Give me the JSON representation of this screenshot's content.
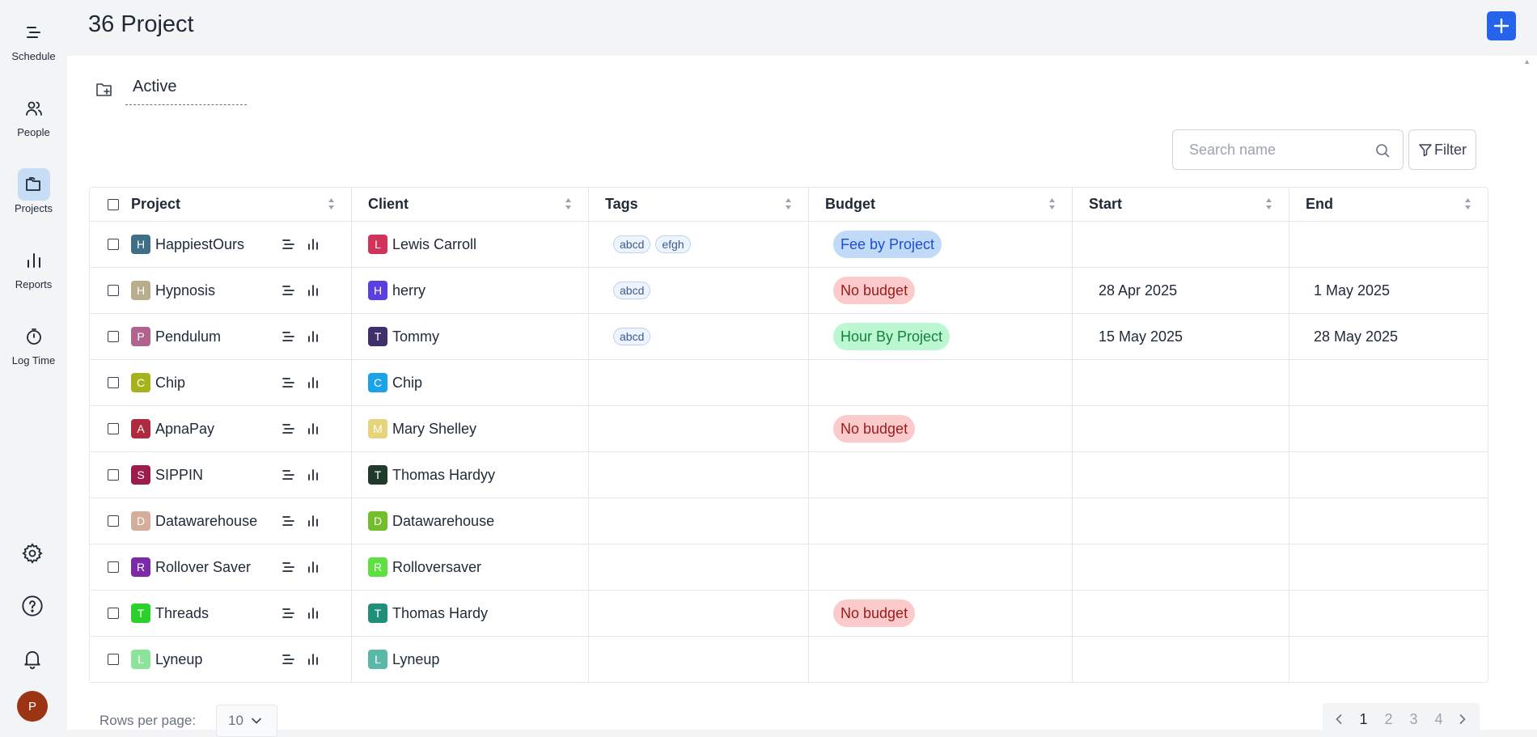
{
  "colors": {
    "accent": "#2563eb",
    "sidebar_active": "#c7dcf5",
    "budget_fee": "#c1daf8",
    "budget_none": "#fbcaca",
    "budget_hour": "#bbf7d0",
    "avatar": "#9a3412"
  },
  "sidebar": {
    "items": [
      {
        "label": "Schedule",
        "icon": "schedule-icon"
      },
      {
        "label": "People",
        "icon": "people-icon"
      },
      {
        "label": "Projects",
        "icon": "projects-folder-icon",
        "active": true
      },
      {
        "label": "Reports",
        "icon": "reports-bar-icon"
      },
      {
        "label": "Log Time",
        "icon": "stopwatch-icon"
      }
    ],
    "bottom_icons": [
      "gear-icon",
      "help-icon",
      "bell-icon"
    ],
    "avatar_initial": "P"
  },
  "header": {
    "title": "36 Project",
    "add_icon": "plus-icon"
  },
  "tabs": {
    "active_label": "Active"
  },
  "search": {
    "placeholder": "Search name",
    "value": ""
  },
  "filter": {
    "label": "Filter"
  },
  "table": {
    "columns": [
      "Project",
      "Client",
      "Tags",
      "Budget",
      "Start",
      "End"
    ],
    "rows": [
      {
        "initial": "H",
        "project": "HappiestOurs",
        "color": "#3f6e87",
        "client_initial": "L",
        "client": "Lewis Carroll",
        "client_color": "#d1335b",
        "tags": [
          "abcd",
          "efgh"
        ],
        "budget": "Fee by Project",
        "budget_type": "fee",
        "start": "",
        "end": ""
      },
      {
        "initial": "H",
        "project": "Hypnosis",
        "color": "#b8ad8c",
        "client_initial": "H",
        "client": "herry",
        "client_color": "#5b3fe0",
        "tags": [
          "abcd"
        ],
        "budget": "No budget",
        "budget_type": "no",
        "start": "28 Apr 2025",
        "end": "1 May 2025"
      },
      {
        "initial": "P",
        "project": "Pendulum",
        "color": "#b0648d",
        "client_initial": "T",
        "client": "Tommy",
        "client_color": "#3f2f6b",
        "tags": [
          "abcd"
        ],
        "budget": "Hour By Project",
        "budget_type": "hour",
        "start": "15 May 2025",
        "end": "28 May 2025"
      },
      {
        "initial": "C",
        "project": "Chip",
        "color": "#a6b31c",
        "client_initial": "C",
        "client": "Chip",
        "client_color": "#1aa3e8",
        "tags": [],
        "budget": "",
        "budget_type": "",
        "start": "",
        "end": ""
      },
      {
        "initial": "A",
        "project": "ApnaPay",
        "color": "#b02a3e",
        "client_initial": "M",
        "client": "Mary Shelley",
        "client_color": "#e5d47a",
        "tags": [],
        "budget": "No budget",
        "budget_type": "no",
        "start": "",
        "end": ""
      },
      {
        "initial": "S",
        "project": "SIPPIN",
        "color": "#9c1c4c",
        "client_initial": "T",
        "client": "Thomas Hardyy",
        "client_color": "#1f3a2a",
        "tags": [],
        "budget": "",
        "budget_type": "",
        "start": "",
        "end": ""
      },
      {
        "initial": "D",
        "project": "Datawarehouse",
        "color": "#d4ae9c",
        "client_initial": "D",
        "client": "Datawarehouse",
        "client_color": "#72bf2a",
        "tags": [],
        "budget": "",
        "budget_type": "",
        "start": "",
        "end": ""
      },
      {
        "initial": "R",
        "project": "Rollover Saver",
        "color": "#7d2aa8",
        "client_initial": "R",
        "client": "Rolloversaver",
        "client_color": "#5ee040",
        "tags": [],
        "budget": "",
        "budget_type": "",
        "start": "",
        "end": ""
      },
      {
        "initial": "T",
        "project": "Threads",
        "color": "#2bd12b",
        "client_initial": "T",
        "client": "Thomas Hardy",
        "client_color": "#1f8f7a",
        "tags": [],
        "budget": "No budget",
        "budget_type": "no",
        "start": "",
        "end": ""
      },
      {
        "initial": "L",
        "project": "Lyneup",
        "color": "#8ce39a",
        "client_initial": "L",
        "client": "Lyneup",
        "client_color": "#5bb8a8",
        "tags": [],
        "budget": "",
        "budget_type": "",
        "start": "",
        "end": ""
      }
    ]
  },
  "footer": {
    "rows_per_page_label": "Rows per page:",
    "rows_per_page_value": "10",
    "pages": [
      "1",
      "2",
      "3",
      "4"
    ],
    "current_page": "1"
  }
}
